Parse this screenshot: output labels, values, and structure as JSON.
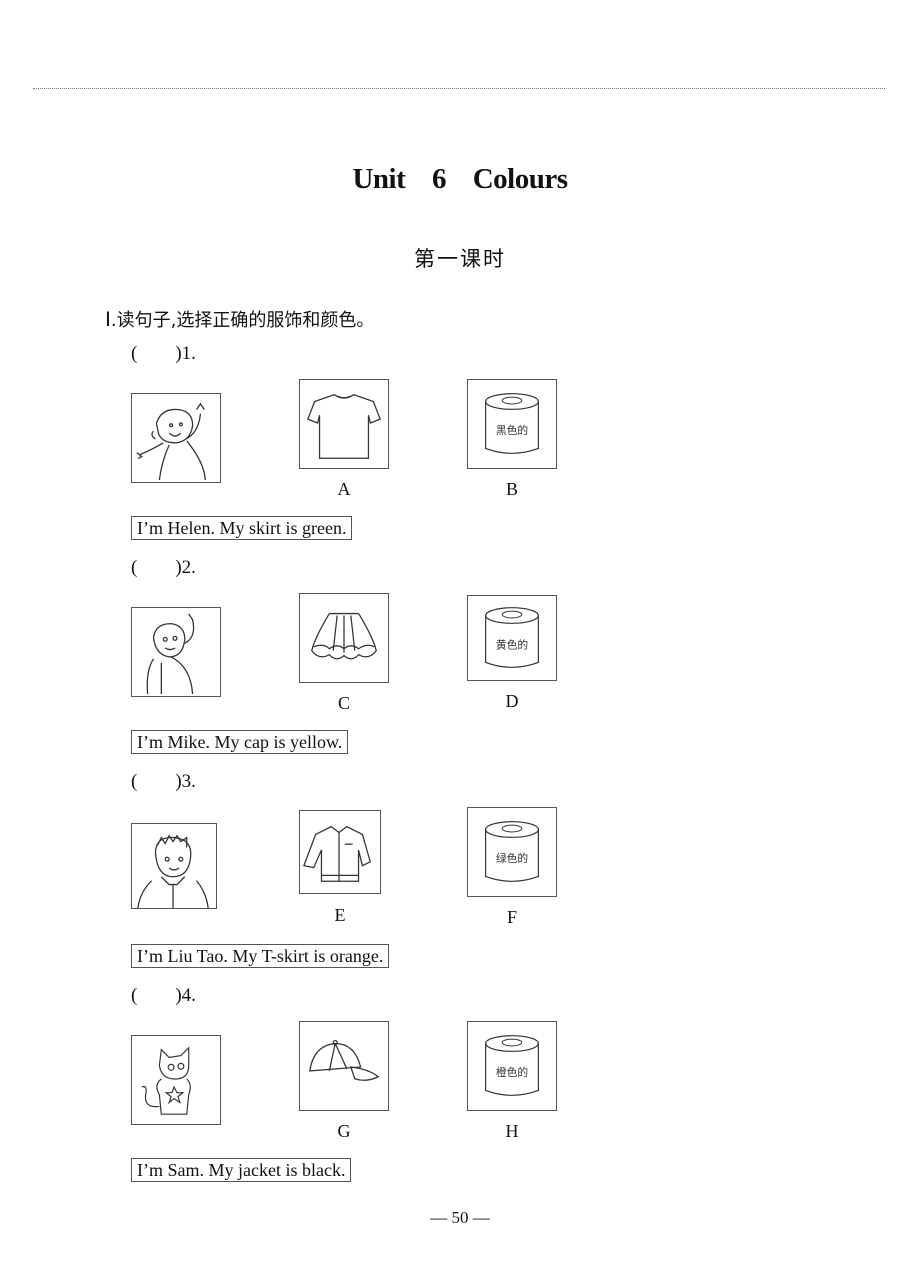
{
  "header": {
    "unit_title": "Unit 6    Colours",
    "lesson_title": "第一课时"
  },
  "section": {
    "roman": "Ⅰ",
    "instruction": ".读句子,选择正确的服饰和颜色。"
  },
  "questions": [
    {
      "number": "(        )1.",
      "character": "girl-helen",
      "options": [
        {
          "letter": "A",
          "type": "clothing",
          "item": "t-shirt-icon"
        },
        {
          "letter": "B",
          "type": "paint-can",
          "label": "黑色的"
        }
      ],
      "sentence": "I’m Helen. My skirt is green."
    },
    {
      "number": "(        )2.",
      "character": "boy-mike",
      "options": [
        {
          "letter": "C",
          "type": "clothing",
          "item": "skirt-icon"
        },
        {
          "letter": "D",
          "type": "paint-can",
          "label": "黄色的"
        }
      ],
      "sentence": "I’m Mike. My cap is yellow."
    },
    {
      "number": "(        )3.",
      "character": "boy-liu-tao",
      "options": [
        {
          "letter": "E",
          "type": "clothing",
          "item": "jacket-icon"
        },
        {
          "letter": "F",
          "type": "paint-can",
          "label": "绿色的"
        }
      ],
      "sentence": "I’m Liu Tao. My T-skirt is orange."
    },
    {
      "number": "(        )4.",
      "character": "cat-sam",
      "options": [
        {
          "letter": "G",
          "type": "clothing",
          "item": "cap-icon"
        },
        {
          "letter": "H",
          "type": "paint-can",
          "label": "橙色的"
        }
      ],
      "sentence": "I’m Sam. My jacket is black."
    }
  ],
  "footer": {
    "page_number": "— 50 —"
  }
}
